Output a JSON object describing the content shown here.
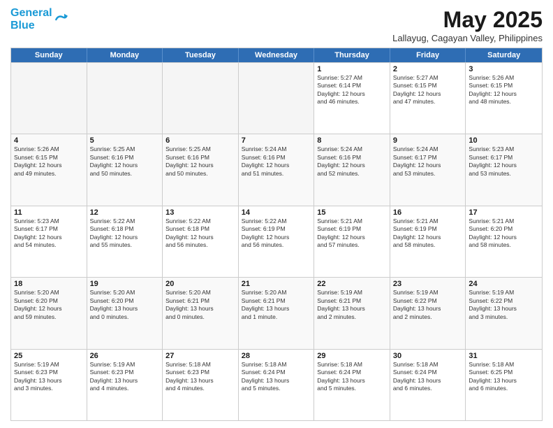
{
  "logo": {
    "line1": "General",
    "line2": "Blue"
  },
  "title": "May 2025",
  "location": "Lallayug, Cagayan Valley, Philippines",
  "header_days": [
    "Sunday",
    "Monday",
    "Tuesday",
    "Wednesday",
    "Thursday",
    "Friday",
    "Saturday"
  ],
  "rows": [
    [
      {
        "day": "",
        "text": "",
        "empty": true
      },
      {
        "day": "",
        "text": "",
        "empty": true
      },
      {
        "day": "",
        "text": "",
        "empty": true
      },
      {
        "day": "",
        "text": "",
        "empty": true
      },
      {
        "day": "1",
        "text": "Sunrise: 5:27 AM\nSunset: 6:14 PM\nDaylight: 12 hours\nand 46 minutes."
      },
      {
        "day": "2",
        "text": "Sunrise: 5:27 AM\nSunset: 6:15 PM\nDaylight: 12 hours\nand 47 minutes."
      },
      {
        "day": "3",
        "text": "Sunrise: 5:26 AM\nSunset: 6:15 PM\nDaylight: 12 hours\nand 48 minutes."
      }
    ],
    [
      {
        "day": "4",
        "text": "Sunrise: 5:26 AM\nSunset: 6:15 PM\nDaylight: 12 hours\nand 49 minutes."
      },
      {
        "day": "5",
        "text": "Sunrise: 5:25 AM\nSunset: 6:16 PM\nDaylight: 12 hours\nand 50 minutes."
      },
      {
        "day": "6",
        "text": "Sunrise: 5:25 AM\nSunset: 6:16 PM\nDaylight: 12 hours\nand 50 minutes."
      },
      {
        "day": "7",
        "text": "Sunrise: 5:24 AM\nSunset: 6:16 PM\nDaylight: 12 hours\nand 51 minutes."
      },
      {
        "day": "8",
        "text": "Sunrise: 5:24 AM\nSunset: 6:16 PM\nDaylight: 12 hours\nand 52 minutes."
      },
      {
        "day": "9",
        "text": "Sunrise: 5:24 AM\nSunset: 6:17 PM\nDaylight: 12 hours\nand 53 minutes."
      },
      {
        "day": "10",
        "text": "Sunrise: 5:23 AM\nSunset: 6:17 PM\nDaylight: 12 hours\nand 53 minutes."
      }
    ],
    [
      {
        "day": "11",
        "text": "Sunrise: 5:23 AM\nSunset: 6:17 PM\nDaylight: 12 hours\nand 54 minutes."
      },
      {
        "day": "12",
        "text": "Sunrise: 5:22 AM\nSunset: 6:18 PM\nDaylight: 12 hours\nand 55 minutes."
      },
      {
        "day": "13",
        "text": "Sunrise: 5:22 AM\nSunset: 6:18 PM\nDaylight: 12 hours\nand 56 minutes."
      },
      {
        "day": "14",
        "text": "Sunrise: 5:22 AM\nSunset: 6:19 PM\nDaylight: 12 hours\nand 56 minutes."
      },
      {
        "day": "15",
        "text": "Sunrise: 5:21 AM\nSunset: 6:19 PM\nDaylight: 12 hours\nand 57 minutes."
      },
      {
        "day": "16",
        "text": "Sunrise: 5:21 AM\nSunset: 6:19 PM\nDaylight: 12 hours\nand 58 minutes."
      },
      {
        "day": "17",
        "text": "Sunrise: 5:21 AM\nSunset: 6:20 PM\nDaylight: 12 hours\nand 58 minutes."
      }
    ],
    [
      {
        "day": "18",
        "text": "Sunrise: 5:20 AM\nSunset: 6:20 PM\nDaylight: 12 hours\nand 59 minutes."
      },
      {
        "day": "19",
        "text": "Sunrise: 5:20 AM\nSunset: 6:20 PM\nDaylight: 13 hours\nand 0 minutes."
      },
      {
        "day": "20",
        "text": "Sunrise: 5:20 AM\nSunset: 6:21 PM\nDaylight: 13 hours\nand 0 minutes."
      },
      {
        "day": "21",
        "text": "Sunrise: 5:20 AM\nSunset: 6:21 PM\nDaylight: 13 hours\nand 1 minute."
      },
      {
        "day": "22",
        "text": "Sunrise: 5:19 AM\nSunset: 6:21 PM\nDaylight: 13 hours\nand 2 minutes."
      },
      {
        "day": "23",
        "text": "Sunrise: 5:19 AM\nSunset: 6:22 PM\nDaylight: 13 hours\nand 2 minutes."
      },
      {
        "day": "24",
        "text": "Sunrise: 5:19 AM\nSunset: 6:22 PM\nDaylight: 13 hours\nand 3 minutes."
      }
    ],
    [
      {
        "day": "25",
        "text": "Sunrise: 5:19 AM\nSunset: 6:23 PM\nDaylight: 13 hours\nand 3 minutes."
      },
      {
        "day": "26",
        "text": "Sunrise: 5:19 AM\nSunset: 6:23 PM\nDaylight: 13 hours\nand 4 minutes."
      },
      {
        "day": "27",
        "text": "Sunrise: 5:18 AM\nSunset: 6:23 PM\nDaylight: 13 hours\nand 4 minutes."
      },
      {
        "day": "28",
        "text": "Sunrise: 5:18 AM\nSunset: 6:24 PM\nDaylight: 13 hours\nand 5 minutes."
      },
      {
        "day": "29",
        "text": "Sunrise: 5:18 AM\nSunset: 6:24 PM\nDaylight: 13 hours\nand 5 minutes."
      },
      {
        "day": "30",
        "text": "Sunrise: 5:18 AM\nSunset: 6:24 PM\nDaylight: 13 hours\nand 6 minutes."
      },
      {
        "day": "31",
        "text": "Sunrise: 5:18 AM\nSunset: 6:25 PM\nDaylight: 13 hours\nand 6 minutes."
      }
    ]
  ]
}
